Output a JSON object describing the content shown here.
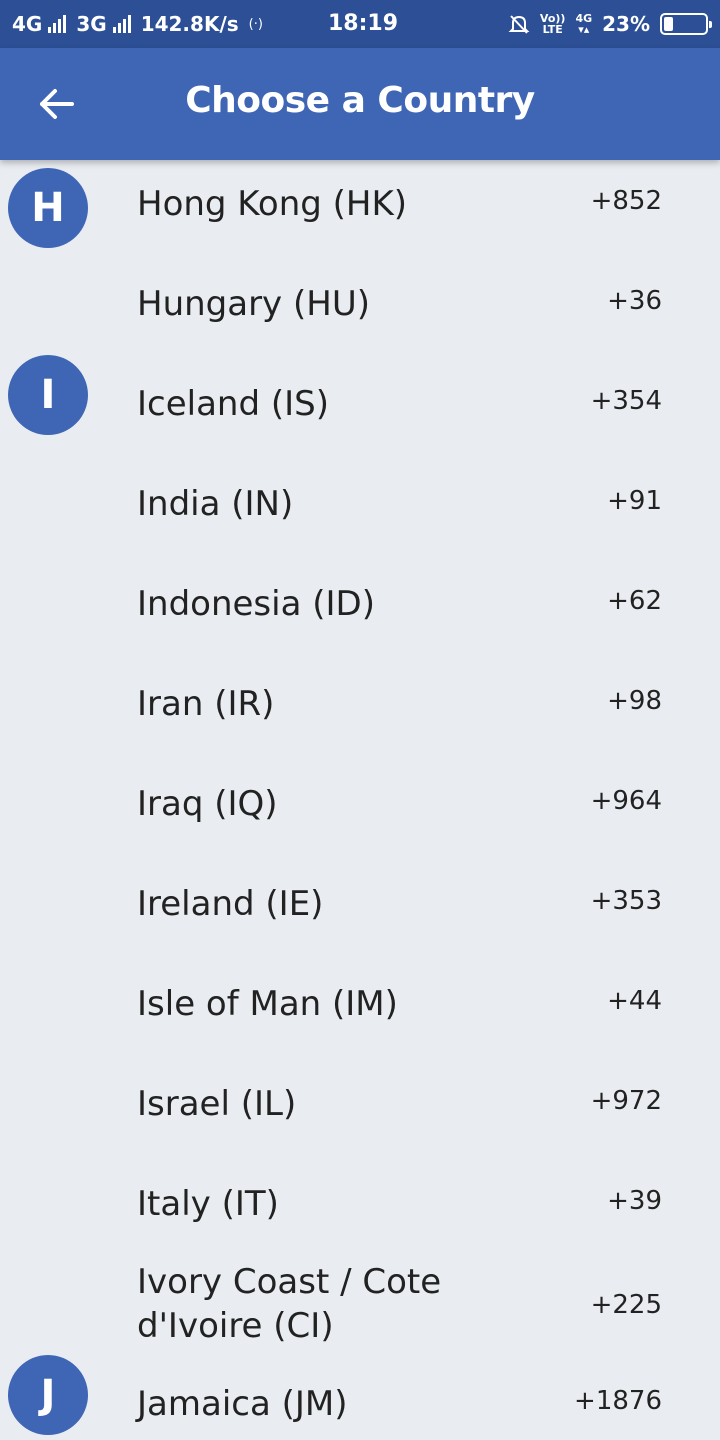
{
  "status_bar": {
    "network1": "4G",
    "network2": "3G",
    "speed": "142.8K/s",
    "time": "18:19",
    "volte_top": "Vo))",
    "volte_bottom": "LTE",
    "data_type": "4G",
    "battery_percent": "23%",
    "battery_level": 0.23
  },
  "app_bar": {
    "title": "Choose a Country",
    "back_icon": "arrow-left-icon"
  },
  "colors": {
    "status_bar": "#2c4f95",
    "app_bar": "#3f66b5",
    "badge": "#3f66b5",
    "background": "#e9edf1",
    "text": "#222222"
  },
  "countries": [
    {
      "letter": "H",
      "name": "Hong Kong (HK)",
      "code": "+852"
    },
    {
      "letter": "",
      "name": "Hungary (HU)",
      "code": "+36"
    },
    {
      "letter": "I",
      "name": "Iceland (IS)",
      "code": "+354"
    },
    {
      "letter": "",
      "name": "India (IN)",
      "code": "+91"
    },
    {
      "letter": "",
      "name": "Indonesia (ID)",
      "code": "+62"
    },
    {
      "letter": "",
      "name": "Iran (IR)",
      "code": "+98"
    },
    {
      "letter": "",
      "name": "Iraq (IQ)",
      "code": "+964"
    },
    {
      "letter": "",
      "name": "Ireland (IE)",
      "code": "+353"
    },
    {
      "letter": "",
      "name": "Isle of Man (IM)",
      "code": "+44"
    },
    {
      "letter": "",
      "name": "Israel (IL)",
      "code": "+972"
    },
    {
      "letter": "",
      "name": "Italy (IT)",
      "code": "+39"
    },
    {
      "letter": "",
      "name": "Ivory Coast / Cote d'Ivoire (CI)",
      "code": "+225"
    },
    {
      "letter": "J",
      "name": "Jamaica (JM)",
      "code": "+1876"
    }
  ]
}
